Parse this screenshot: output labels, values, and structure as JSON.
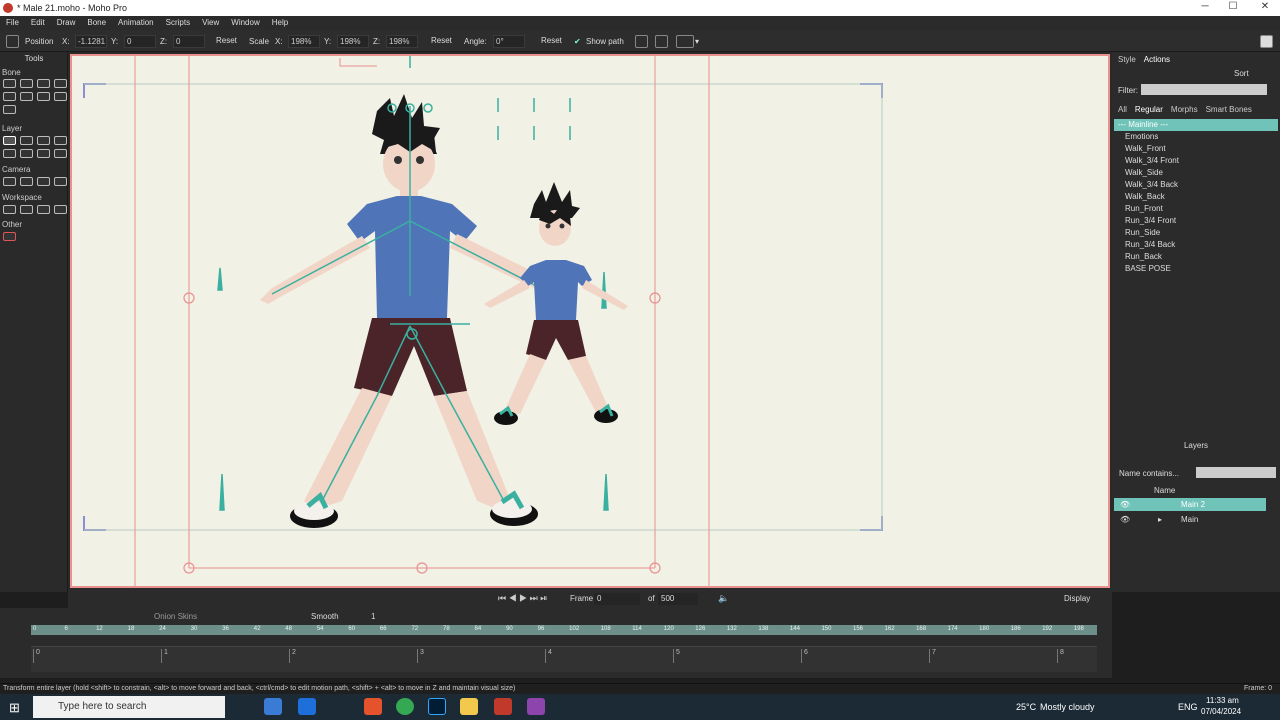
{
  "window": {
    "title": "* Male 21.moho - Moho Pro",
    "minimize": "─",
    "maximize": "☐",
    "close": "✕"
  },
  "menu": [
    "File",
    "Edit",
    "Draw",
    "Bone",
    "Animation",
    "Scripts",
    "View",
    "Window",
    "Help"
  ],
  "tool_options": {
    "position_label": "Position",
    "x_label": "X:",
    "x_value": "-1.1281",
    "y_label": "Y:",
    "y_value": "0",
    "z_label": "Z:",
    "z_value": "0",
    "reset1": "Reset",
    "scale_label": "Scale",
    "sx_label": "X:",
    "sx_value": "198%",
    "sy_label": "Y:",
    "sy_value": "198%",
    "sz_label": "Z:",
    "sz_value": "198%",
    "reset2": "Reset",
    "angle_label": "Angle:",
    "angle_value": "0°",
    "reset3": "Reset",
    "show_path_label": "Show path",
    "show_path_checked": true
  },
  "tools": {
    "title": "Tools",
    "sections": [
      "Bone",
      "Layer",
      "Camera",
      "Workspace",
      "Other"
    ]
  },
  "right_panel": {
    "tabs": [
      "Style",
      "Actions"
    ],
    "sort_label": "Sort",
    "filter_label": "Filter:",
    "sub_tabs": [
      "All",
      "Regular",
      "Morphs",
      "Smart Bones"
    ],
    "actions": [
      "--- Mainline ---",
      "Emotions",
      "Walk_Front",
      "Walk_3/4 Front",
      "Walk_Side",
      "Walk_3/4 Back",
      "Walk_Back",
      "Run_Front",
      "Run_3/4 Front",
      "Run_Side",
      "Run_3/4 Back",
      "Run_Back",
      "BASE POSE"
    ]
  },
  "layers": {
    "title": "Layers",
    "filter_label": "Name contains...",
    "name_header": "Name",
    "items": [
      "Main 2",
      "Main"
    ]
  },
  "playback": {
    "frame_label": "Frame",
    "frame_value": "0",
    "of_label": "of",
    "total_frames": "500",
    "display_label": "Display"
  },
  "timeline": {
    "onion_skins": "Onion Skins",
    "interp": "Smooth",
    "interp_num": "1",
    "ruler_ticks": [
      "0",
      "6",
      "12",
      "18",
      "24",
      "30",
      "36",
      "42",
      "48",
      "54",
      "60",
      "66",
      "72",
      "78",
      "84",
      "90",
      "96",
      "102",
      "108",
      "114",
      "120",
      "126",
      "132",
      "138",
      "144",
      "150",
      "156",
      "162",
      "168",
      "174",
      "180",
      "186",
      "192",
      "198"
    ],
    "seconds": [
      "0",
      "1",
      "2",
      "3",
      "4",
      "5",
      "6",
      "7",
      "8"
    ]
  },
  "status": {
    "message": "Transform entire layer (hold <shift> to constrain, <alt> to move forward and back, <ctrl/cmd> to edit motion path, <shift> + <alt> to move in Z and maintain visual size)",
    "frame": "Frame: 0"
  },
  "taskbar": {
    "search_placeholder": "Type here to search",
    "weather_temp": "25°C",
    "weather_desc": "Mostly cloudy",
    "lang": "ENG",
    "time": "11:33 am",
    "date": "07/04/2024"
  },
  "colors": {
    "accent": "#6fc3b8",
    "canvas_border": "#e8918f",
    "canvas_bg": "#f2f1e6",
    "shirt": "#4f74b8",
    "shorts": "#4a2428",
    "skin": "#f1d6c8",
    "bone": "#3ab0a0"
  }
}
